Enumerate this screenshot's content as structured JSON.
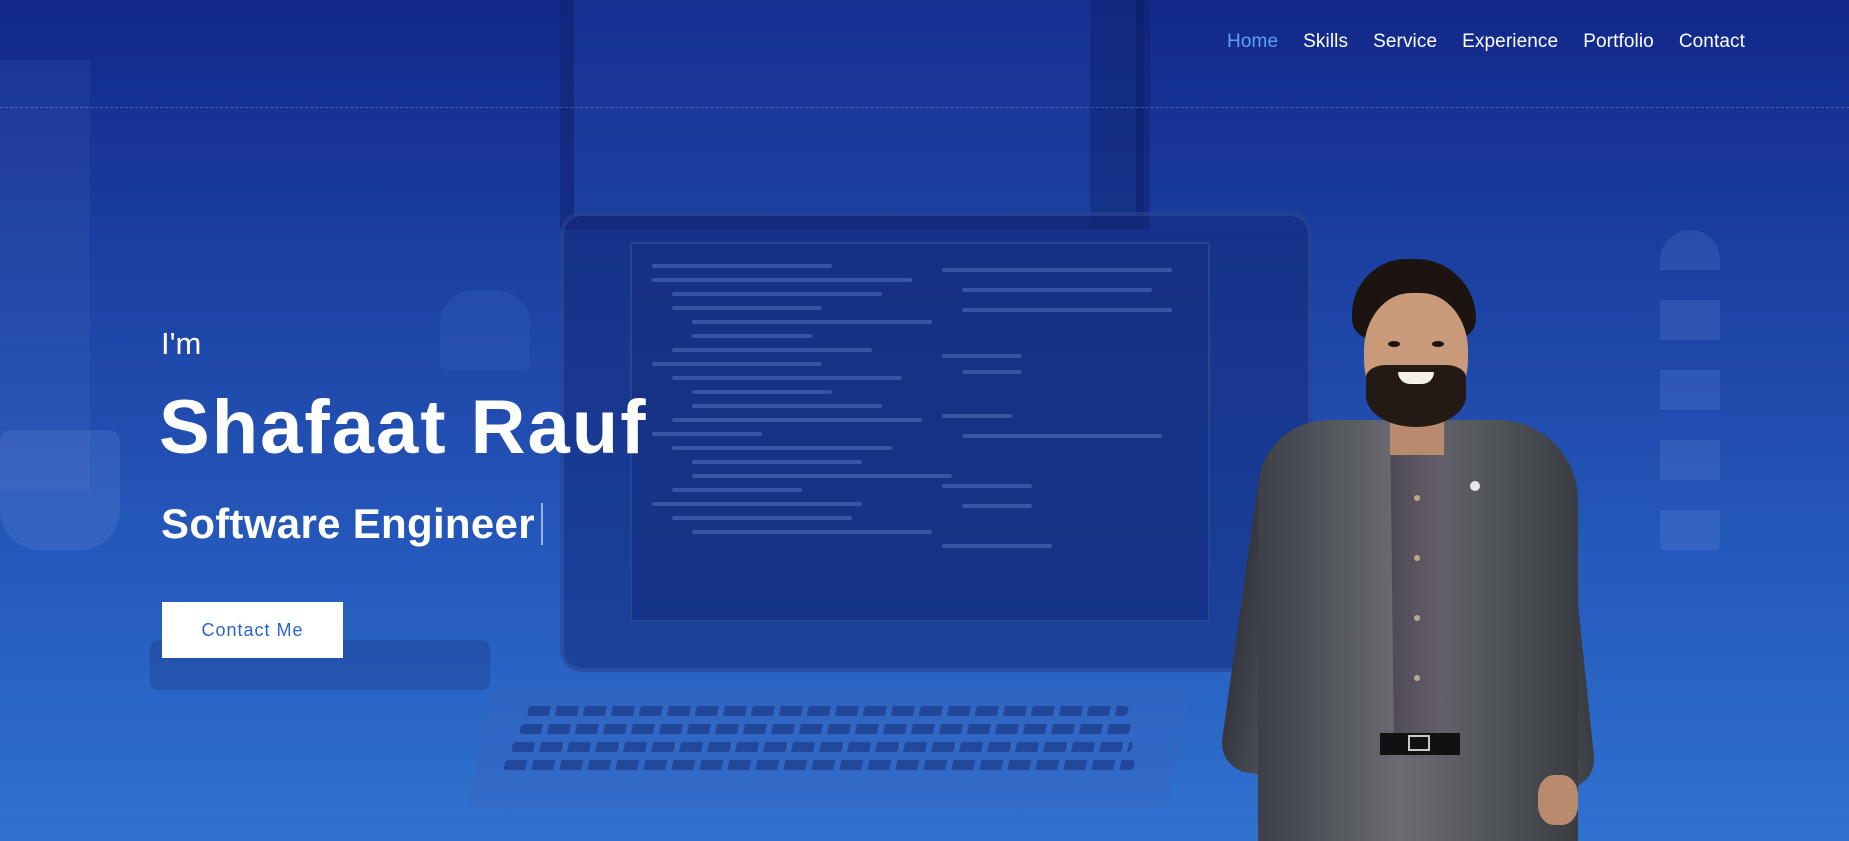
{
  "nav": {
    "items": [
      {
        "label": "Home",
        "active": true
      },
      {
        "label": "Skills",
        "active": false
      },
      {
        "label": "Service",
        "active": false
      },
      {
        "label": "Experience",
        "active": false
      },
      {
        "label": "Portfolio",
        "active": false
      },
      {
        "label": "Contact",
        "active": false
      }
    ]
  },
  "hero": {
    "intro": "I'm",
    "name": "Shafaat Rauf",
    "role": "Software Engineer",
    "cta_label": "Contact Me",
    "portrait_icon": "person-portrait"
  },
  "colors": {
    "accent": "#5fa0f0",
    "background_top": "#11288a",
    "background_bottom": "#2f72cf",
    "button_text": "#2b66c6"
  }
}
